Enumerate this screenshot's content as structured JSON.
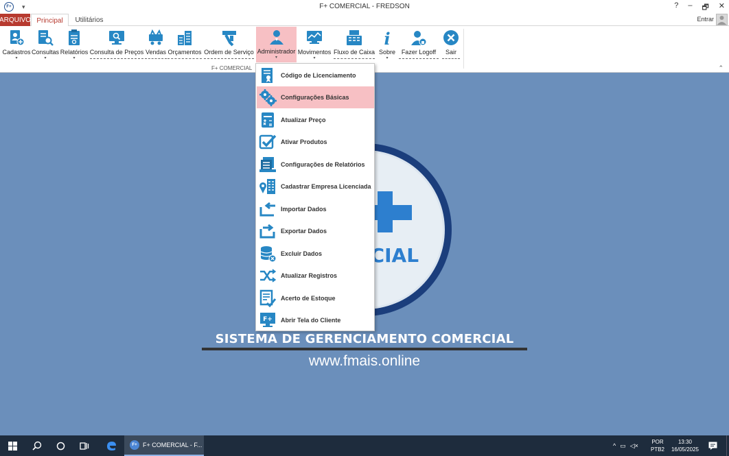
{
  "window": {
    "title": "F+ COMERCIAL - FREDSON",
    "controls": [
      "?",
      "–",
      "🗗",
      "✕"
    ]
  },
  "tabs": {
    "arquivo": "ARQUIVO",
    "principal": "Principal",
    "utilitarios": "Utilitários",
    "entrar": "Entrar"
  },
  "ribbon": {
    "group_label": "F+ COMERCIAL",
    "buttons": [
      {
        "label": "Cadastros",
        "icon": "person-add-icon"
      },
      {
        "label": "Consultas",
        "icon": "search-doc-icon"
      },
      {
        "label": "Relatórios",
        "icon": "report-icon"
      },
      {
        "label": "Consulta de Preços",
        "icon": "monitor-search-icon"
      },
      {
        "label": "Vendas",
        "icon": "cart-icon"
      },
      {
        "label": "Orçamentos",
        "icon": "calculator-icon"
      },
      {
        "label": "Ordem de Serviço",
        "icon": "tools-icon"
      },
      {
        "label": "Administrador",
        "icon": "admin-icon"
      },
      {
        "label": "Movimentos",
        "icon": "chart-monitor-icon"
      },
      {
        "label": "Fluxo de Caixa",
        "icon": "cash-register-icon"
      },
      {
        "label": "Sobre",
        "icon": "info-icon"
      },
      {
        "label": "Fazer Logoff",
        "icon": "logoff-icon"
      },
      {
        "label": "Sair",
        "icon": "exit-icon"
      }
    ]
  },
  "menu": {
    "items": [
      {
        "label": "Código de Licenciamento",
        "icon": "license-icon"
      },
      {
        "label": "Configurações Básicas",
        "icon": "gears-icon",
        "highlighted": true
      },
      {
        "label": "Atualizar Preço",
        "icon": "calculator-icon"
      },
      {
        "label": "Ativar Produtos",
        "icon": "checkbox-icon"
      },
      {
        "label": "Configurações de Relatórios",
        "icon": "reports-config-icon"
      },
      {
        "label": "Cadastrar Empresa Licenciada",
        "icon": "building-icon"
      },
      {
        "label": "Importar Dados",
        "icon": "import-icon"
      },
      {
        "label": "Exportar Dados",
        "icon": "export-icon"
      },
      {
        "label": "Excluir Dados",
        "icon": "database-delete-icon"
      },
      {
        "label": "Atualizar Registros",
        "icon": "shuffle-icon"
      },
      {
        "label": "Acerto de Estoque",
        "icon": "stock-doc-icon"
      },
      {
        "label": "Abrir Tela do Cliente",
        "icon": "client-screen-icon"
      }
    ]
  },
  "background": {
    "logo_text": "RCIAL",
    "slogan": "SISTEMA DE GERENCIAMENTO COMERCIAL",
    "website": "www.fmais.online"
  },
  "taskbar": {
    "app_label": "F+ COMERCIAL - F...",
    "lang_top": "POR",
    "lang_bottom": "PTB2",
    "time": "13:30",
    "date": "16/05/2025"
  },
  "colors": {
    "accent_red": "#b73a2f",
    "ribbon_icon": "#2787c4",
    "menu_highlight": "#f7c0c4",
    "desktop_bg": "#6b8fbb",
    "taskbar_bg": "#1e2c3d"
  }
}
